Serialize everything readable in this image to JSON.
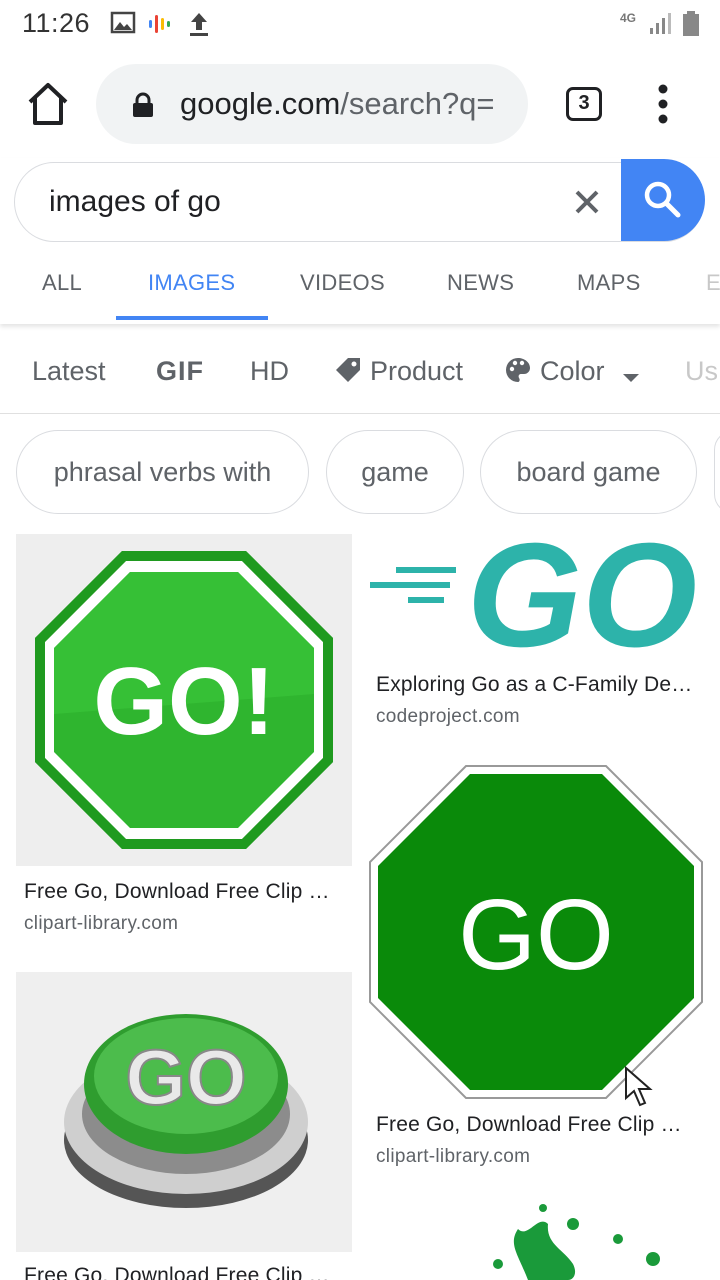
{
  "status_bar": {
    "time": "11:26",
    "network": "4G",
    "icons": [
      "image-icon",
      "podcast-icon",
      "upload-icon",
      "signal-icon",
      "battery-icon"
    ]
  },
  "browser": {
    "url_host": "google.com",
    "url_path": "/search?q=",
    "tab_count": "3"
  },
  "search": {
    "query": "images of go"
  },
  "tabs": [
    {
      "label": "ALL"
    },
    {
      "label": "IMAGES"
    },
    {
      "label": "VIDEOS"
    },
    {
      "label": "NEWS"
    },
    {
      "label": "MAPS"
    },
    {
      "label": "E"
    }
  ],
  "filters": [
    {
      "label": "Latest"
    },
    {
      "label": "GIF"
    },
    {
      "label": "HD"
    },
    {
      "label": "Product"
    },
    {
      "label": "Color"
    },
    {
      "label": "Us"
    }
  ],
  "chips": [
    {
      "label": "phrasal verbs with"
    },
    {
      "label": "game"
    },
    {
      "label": "board game"
    }
  ],
  "results": [
    {
      "title": "Free Go, Download Free Clip …",
      "source": "clipart-library.com",
      "image_text": "GO!"
    },
    {
      "title": "Exploring Go as a C-Family De…",
      "source": "codeproject.com",
      "image_text": "GO"
    },
    {
      "title": "Free Go, Download Free Clip …",
      "source": "clipart-library.com",
      "image_text": "GO"
    },
    {
      "title": "Free Go, Download Free Clip …",
      "source": "",
      "image_text": "GO"
    }
  ],
  "colors": {
    "accent": "#4285f4",
    "go_green": "#0a8a0a",
    "go_teal": "#2db3aa"
  }
}
